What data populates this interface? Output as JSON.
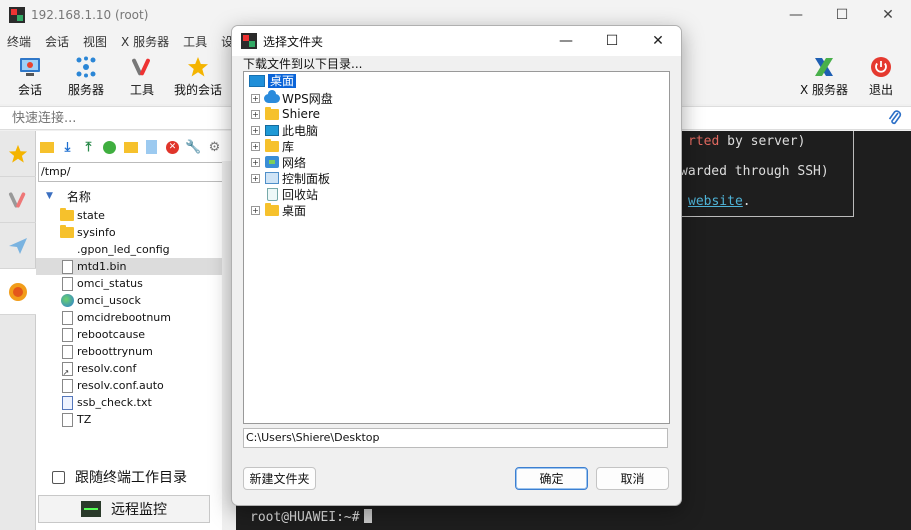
{
  "window": {
    "title": "192.168.1.10 (root)",
    "controls": {
      "minimize": "—",
      "maximize": "☐",
      "close": "✕"
    }
  },
  "menubar": {
    "items": [
      "终端",
      "会话",
      "视图",
      "X 服务器",
      "工具",
      "设"
    ]
  },
  "toolbar": {
    "items": [
      {
        "label": "会话",
        "icon": "session-icon"
      },
      {
        "label": "服务器",
        "icon": "servers-icon"
      },
      {
        "label": "工具",
        "icon": "tools-icon"
      },
      {
        "label": "我的会话",
        "icon": "star-icon"
      }
    ],
    "right": [
      {
        "label": "X 服务器",
        "icon": "x-server-icon"
      },
      {
        "label": "退出",
        "icon": "power-icon"
      }
    ]
  },
  "quickbar": {
    "placeholder": "快速连接..."
  },
  "sftp": {
    "path": "/tmp/",
    "column_name": "名称",
    "files": [
      {
        "name": "state",
        "type": "folder"
      },
      {
        "name": "sysinfo",
        "type": "folder"
      },
      {
        "name": ".gpon_led_config",
        "type": "none"
      },
      {
        "name": "mtd1.bin",
        "type": "doc",
        "selected": true
      },
      {
        "name": "omci_status",
        "type": "doc"
      },
      {
        "name": "omci_usock",
        "type": "globe"
      },
      {
        "name": "omcidrebootnum",
        "type": "doc"
      },
      {
        "name": "rebootcause",
        "type": "doc"
      },
      {
        "name": "reboottrynum",
        "type": "doc"
      },
      {
        "name": "resolv.conf",
        "type": "link"
      },
      {
        "name": "resolv.conf.auto",
        "type": "doc"
      },
      {
        "name": "ssb_check.txt",
        "type": "txt"
      },
      {
        "name": "TZ",
        "type": "doc"
      }
    ],
    "follow_label": "跟随终端工作目录",
    "monitor_label": "远程监控"
  },
  "terminal": {
    "line1_red": "rted",
    "line1_rest": " by server)",
    "line2": "warded through SSH)",
    "line3_link": "website",
    "line3_rest": ".",
    "prompt": "root@HUAWEI:~#"
  },
  "dialog": {
    "title": "选择文件夹",
    "prompt": "下载文件到以下目录...",
    "root": "桌面",
    "nodes": [
      {
        "label": "WPS网盘",
        "icon": "cloud-icon",
        "expandable": true
      },
      {
        "label": "Shiere",
        "icon": "folder-icon",
        "expandable": true
      },
      {
        "label": "此电脑",
        "icon": "computer-icon",
        "expandable": true
      },
      {
        "label": "库",
        "icon": "library-icon",
        "expandable": true
      },
      {
        "label": "网络",
        "icon": "network-icon",
        "expandable": true
      },
      {
        "label": "控制面板",
        "icon": "control-panel-icon",
        "expandable": true
      },
      {
        "label": "回收站",
        "icon": "recycle-bin-icon",
        "expandable": false
      },
      {
        "label": "桌面",
        "icon": "folder-icon",
        "expandable": true
      }
    ],
    "path": "C:\\Users\\Shiere\\Desktop",
    "new_folder": "新建文件夹",
    "ok": "确定",
    "cancel": "取消",
    "close": "✕",
    "maximize": "☐",
    "minimize": "—"
  },
  "colors": {
    "accent": "#0a64d8",
    "terminal_bg": "#1e1e1e",
    "power": "#e5392f"
  }
}
